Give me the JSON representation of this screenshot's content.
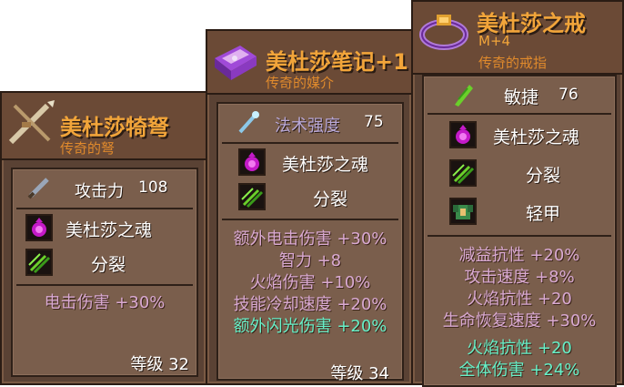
{
  "card1": {
    "title": "美杜莎犄弩",
    "subtitle": "传奇的弩",
    "attack_label": "攻击力",
    "attack_value": "108",
    "traits": [
      "美杜莎之魂",
      "分裂"
    ],
    "stats": [
      "电击伤害 +30%"
    ],
    "level": "等级 32",
    "icon": "crossbow-icon"
  },
  "card2": {
    "title": "美杜莎笔记+1",
    "subtitle": "传奇的媒介",
    "power_label": "法术强度",
    "power_value": "75",
    "traits": [
      "美杜莎之魂",
      "分裂"
    ],
    "stats": [
      "额外电击伤害 +30%",
      "智力 +8",
      "火焰伤害 +10%",
      "技能冷却速度 +20%"
    ],
    "bonus_stat": "额外闪光伤害 +20%",
    "level": "等级 34",
    "icon": "book-icon"
  },
  "card3": {
    "title": "美杜莎之戒",
    "tier": "M+4",
    "subtitle": "传奇的戒指",
    "agility_label": "敏捷",
    "agility_value": "76",
    "traits": [
      "美杜莎之魂",
      "分裂",
      "轻甲"
    ],
    "stats": [
      "减益抗性 +20%",
      "攻击速度 +8%",
      "火焰抗性 +20",
      "生命恢复速度 +30%"
    ],
    "bonus_stats": [
      "火焰抗性 +20",
      "全体伤害 +24%"
    ],
    "icon": "ring-icon"
  },
  "colors": {
    "title": "#f2a53a",
    "stat_pink": "#d9a9d2",
    "stat_teal": "#66f0c8",
    "panel_bg": "#7a5e4c",
    "card_bg": "#5a4234"
  }
}
